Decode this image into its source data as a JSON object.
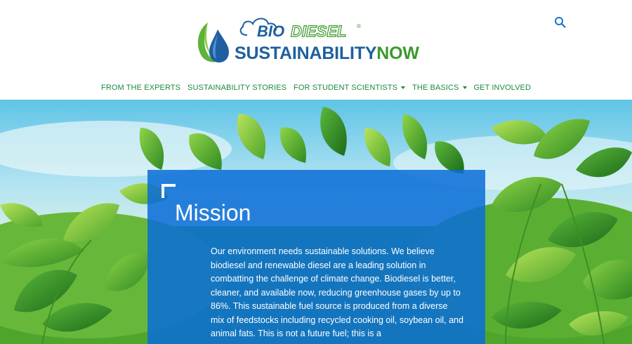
{
  "logo": {
    "bio": "BIO",
    "diesel": "DIESEL",
    "registered": "®",
    "sustainability": "SUSTAINABILITY",
    "now": "NOW"
  },
  "header": {
    "search_icon": "search-icon"
  },
  "nav": {
    "items": [
      {
        "label": "FROM THE EXPERTS",
        "has_dropdown": false
      },
      {
        "label": "SUSTAINABILITY STORIES",
        "has_dropdown": false
      },
      {
        "label": "FOR STUDENT SCIENTISTS",
        "has_dropdown": true
      },
      {
        "label": "THE BASICS",
        "has_dropdown": true
      },
      {
        "label": "GET INVOLVED",
        "has_dropdown": false
      }
    ]
  },
  "mission": {
    "title": "Mission",
    "body": "Our environment needs sustainable solutions. We believe biodiesel and renewable diesel are a leading solution in combatting the challenge of climate change. Biodiesel is better, cleaner, and available now, reducing greenhouse gases by up to 86%. This sustainable fuel source is produced from a diverse mix of feedstocks including recycled cooking oil, soybean oil, and animal fats. This is not a future fuel; this is a"
  },
  "colors": {
    "nav_green": "#1c8a3a",
    "brand_blue": "#1f5fa0",
    "brand_green": "#3a9a2c",
    "card_blue": "#0a6ed7",
    "search_blue": "#1a73c8"
  }
}
